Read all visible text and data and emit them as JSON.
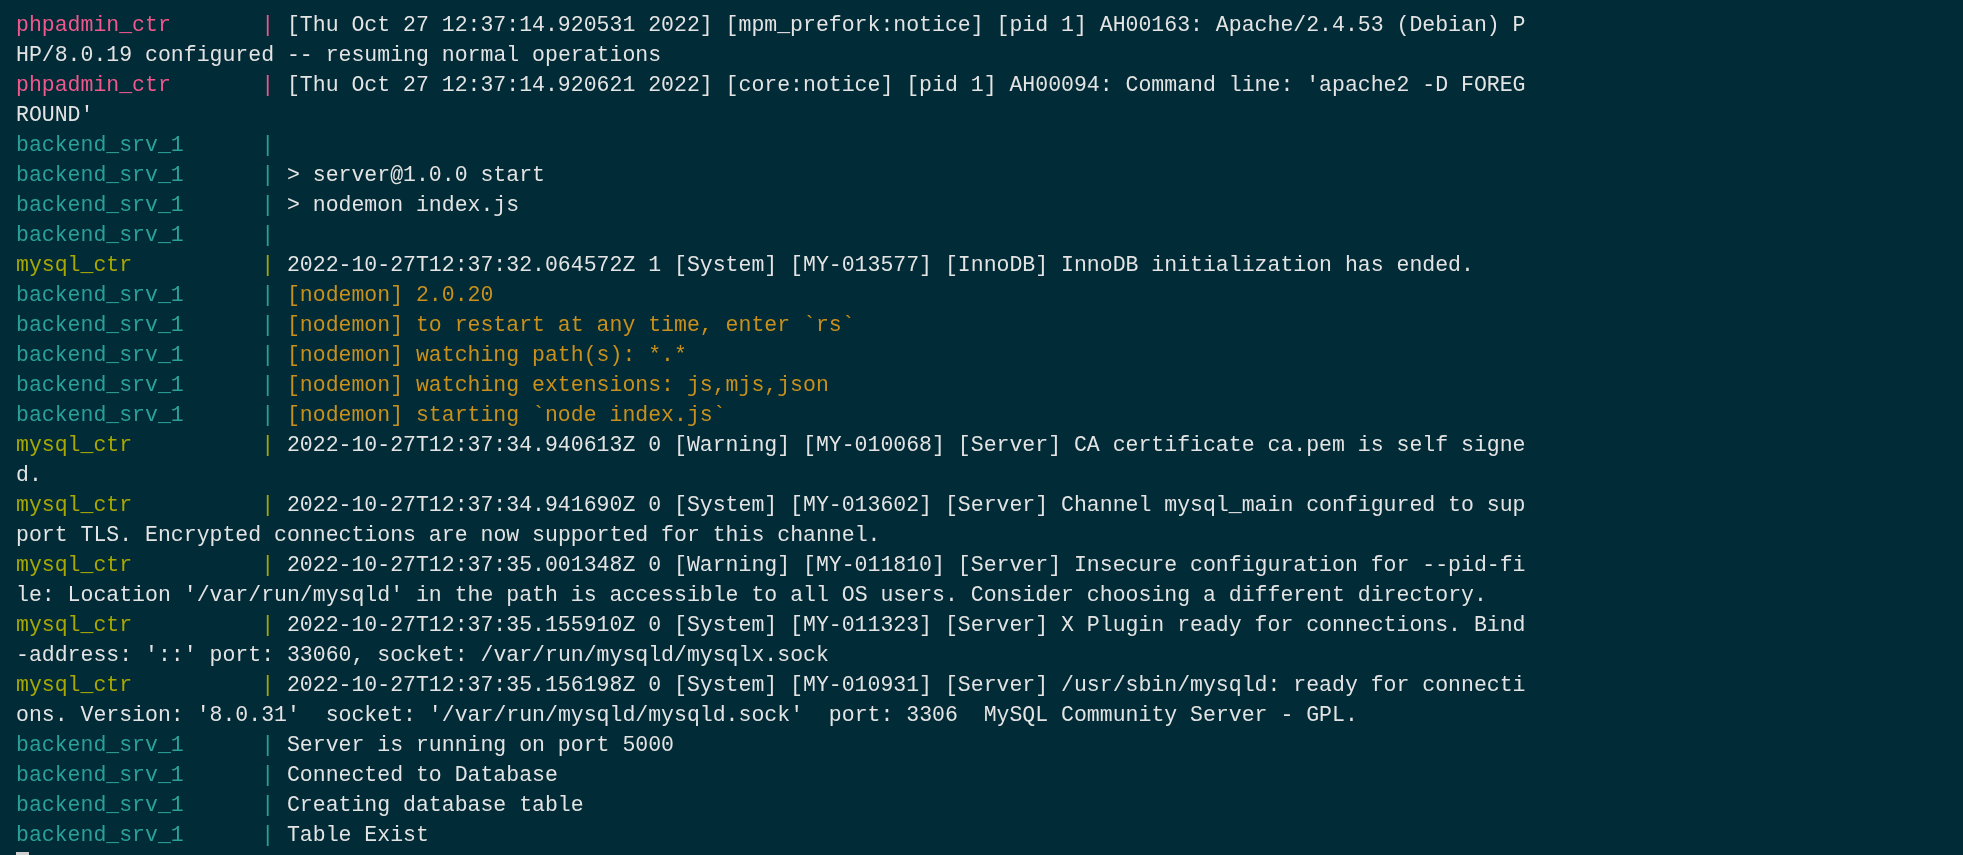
{
  "terminal": {
    "lines": [
      {
        "source": "phpadmin_ctr",
        "color": "#f0578c",
        "separator": "|",
        "message": "[Thu Oct 27 12:37:14.920531 2022] [mpm_prefork:notice] [pid 1] AH00163: Apache/2.4.53 (Debian) P",
        "kind": "plain",
        "wrap": "HP/8.0.19 configured -- resuming normal operations"
      },
      {
        "source": "phpadmin_ctr",
        "color": "#f0578c",
        "separator": "|",
        "message": "[Thu Oct 27 12:37:14.920621 2022] [core:notice] [pid 1] AH00094: Command line: 'apache2 -D FOREG",
        "kind": "plain",
        "wrap": "ROUND'"
      },
      {
        "source": "backend_srv_1",
        "color": "#2aa198",
        "separator": "|"
      },
      {
        "source": "backend_srv_1",
        "color": "#2aa198",
        "separator": "|",
        "message": "> server@1.0.0 start",
        "kind": "plain"
      },
      {
        "source": "backend_srv_1",
        "color": "#2aa198",
        "separator": "|",
        "message": "> nodemon index.js",
        "kind": "plain"
      },
      {
        "source": "backend_srv_1",
        "color": "#2aa198",
        "separator": "|"
      },
      {
        "source": "mysql_ctr",
        "color": "#a8a800",
        "separator": "|",
        "message": "2022-10-27T12:37:32.064572Z 1 [System] [MY-013577] [InnoDB] InnoDB initialization has ended.",
        "kind": "plain"
      },
      {
        "source": "backend_srv_1",
        "color": "#2aa198",
        "separator": "|",
        "message": "[nodemon] 2.0.20",
        "kind": "nodemon"
      },
      {
        "source": "backend_srv_1",
        "color": "#2aa198",
        "separator": "|",
        "message": "[nodemon] to restart at any time, enter `rs`",
        "kind": "nodemon"
      },
      {
        "source": "backend_srv_1",
        "color": "#2aa198",
        "separator": "|",
        "message": "[nodemon] watching path(s): *.*",
        "kind": "nodemon"
      },
      {
        "source": "backend_srv_1",
        "color": "#2aa198",
        "separator": "|",
        "message": "[nodemon] watching extensions: js,mjs,json",
        "kind": "nodemon"
      },
      {
        "source": "backend_srv_1",
        "color": "#2aa198",
        "separator": "|",
        "message": "[nodemon] starting `node index.js`",
        "kind": "nodemon"
      },
      {
        "source": "mysql_ctr",
        "color": "#a8a800",
        "separator": "|",
        "message": "2022-10-27T12:37:34.940613Z 0 [Warning] [MY-010068] [Server] CA certificate ca.pem is self signe",
        "kind": "plain",
        "wrap": "d."
      },
      {
        "source": "mysql_ctr",
        "color": "#a8a800",
        "separator": "|",
        "message": "2022-10-27T12:37:34.941690Z 0 [System] [MY-013602] [Server] Channel mysql_main configured to sup",
        "kind": "plain",
        "wrap": "port TLS. Encrypted connections are now supported for this channel."
      },
      {
        "source": "mysql_ctr",
        "color": "#a8a800",
        "separator": "|",
        "message": "2022-10-27T12:37:35.001348Z 0 [Warning] [MY-011810] [Server] Insecure configuration for --pid-fi",
        "kind": "plain",
        "wrap": "le: Location '/var/run/mysqld' in the path is accessible to all OS users. Consider choosing a different directory."
      },
      {
        "source": "mysql_ctr",
        "color": "#a8a800",
        "separator": "|",
        "message": "2022-10-27T12:37:35.155910Z 0 [System] [MY-011323] [Server] X Plugin ready for connections. Bind",
        "kind": "plain",
        "wrap": "-address: '::' port: 33060, socket: /var/run/mysqld/mysqlx.sock"
      },
      {
        "source": "mysql_ctr",
        "color": "#a8a800",
        "separator": "|",
        "message": "2022-10-27T12:37:35.156198Z 0 [System] [MY-010931] [Server] /usr/sbin/mysqld: ready for connecti",
        "kind": "plain",
        "wrap": "ons. Version: '8.0.31'  socket: '/var/run/mysqld/mysqld.sock'  port: 3306  MySQL Community Server - GPL."
      },
      {
        "source": "backend_srv_1",
        "color": "#2aa198",
        "separator": "|",
        "message": "Server is running on port 5000",
        "kind": "plain"
      },
      {
        "source": "backend_srv_1",
        "color": "#2aa198",
        "separator": "|",
        "message": "Connected to Database",
        "kind": "plain"
      },
      {
        "source": "backend_srv_1",
        "color": "#2aa198",
        "separator": "|",
        "message": "Creating database table",
        "kind": "plain"
      },
      {
        "source": "backend_srv_1",
        "color": "#2aa198",
        "separator": "|",
        "message": "Table Exist",
        "kind": "plain"
      }
    ]
  }
}
